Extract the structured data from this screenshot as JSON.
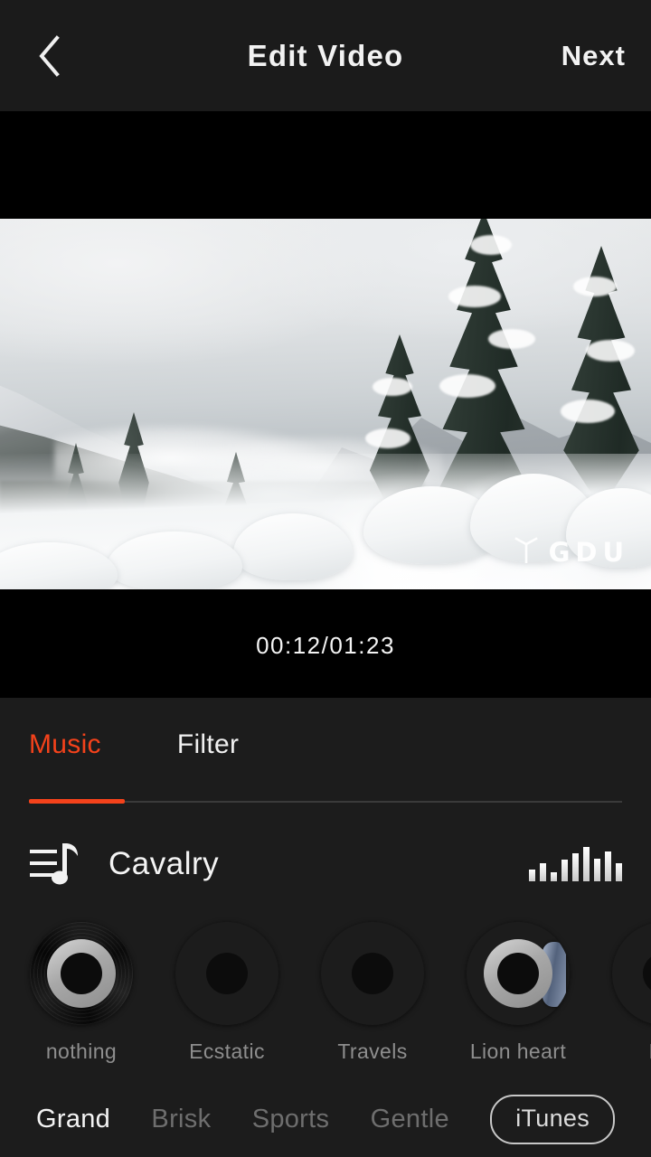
{
  "header": {
    "back_icon": "chevron-left-icon",
    "title": "Edit Video",
    "next_label": "Next"
  },
  "player": {
    "timecode": "00:12/01:23",
    "current_time": "00:12",
    "total_time": "01:23",
    "watermark_text": "GDU",
    "scene_description": "Snow-covered mountain valley with evergreen pines and low fog"
  },
  "tabs": {
    "items": [
      {
        "label": "Music",
        "active": true
      },
      {
        "label": "Filter",
        "active": false
      }
    ],
    "accent_color": "#f4421b"
  },
  "now_playing": {
    "playlist_icon": "playlist-music-note-icon",
    "title": "Cavalry",
    "equalizer_icon": "equalizer-icon",
    "equalizer_bars": [
      13,
      20,
      10,
      24,
      31,
      38,
      25,
      33,
      20
    ]
  },
  "tracks": [
    {
      "name": "nothing",
      "art": "art-vinyl"
    },
    {
      "name": "Ecstatic",
      "art": "art-blue"
    },
    {
      "name": "Travels",
      "art": "art-purple"
    },
    {
      "name": "Lion heart",
      "art": "art-black"
    },
    {
      "name": "Mu",
      "art": "art-white"
    }
  ],
  "categories": {
    "items": [
      {
        "label": "Grand",
        "active": true
      },
      {
        "label": "Brisk",
        "active": false
      },
      {
        "label": "Sports",
        "active": false
      },
      {
        "label": "Gentle",
        "active": false
      }
    ],
    "itunes_label": "iTunes"
  }
}
